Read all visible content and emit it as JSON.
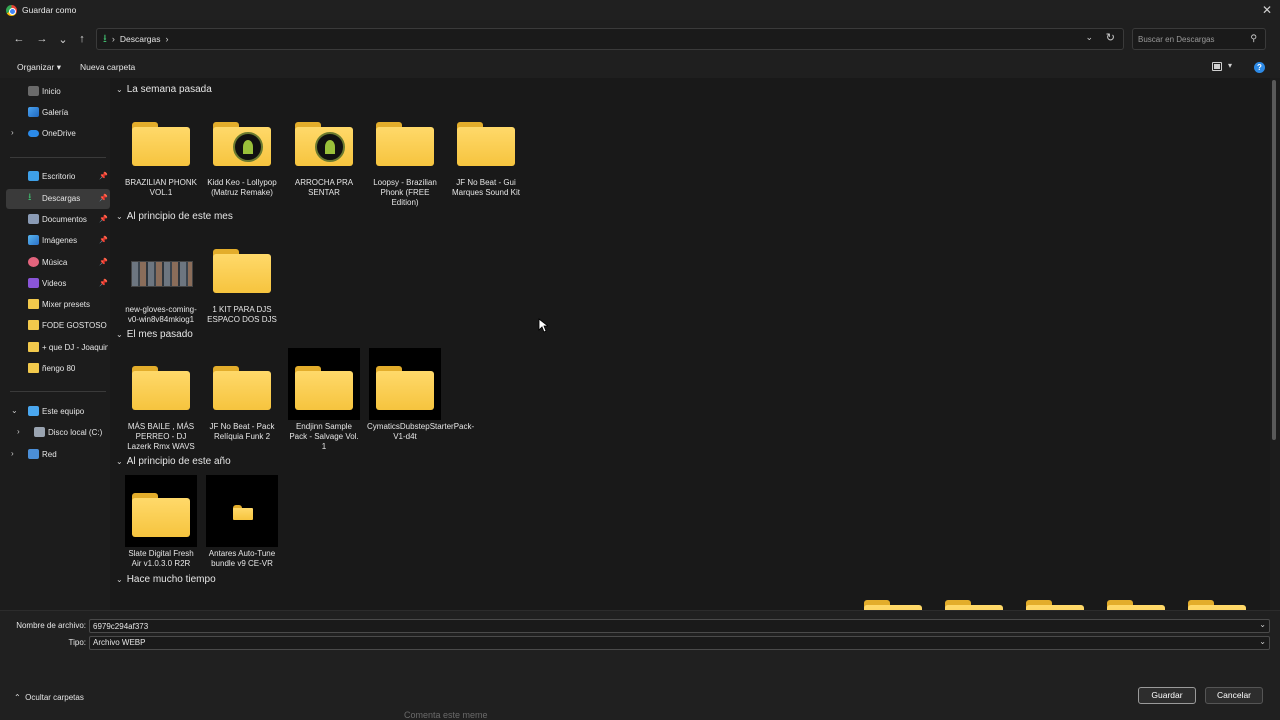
{
  "window": {
    "title": "Guardar como",
    "close_label": "✕"
  },
  "nav": {
    "back": "←",
    "forward": "→",
    "recent": "⌄",
    "up": "↑",
    "breadcrumb": [
      "Descargas"
    ],
    "search_placeholder": "Buscar en Descargas"
  },
  "commands": {
    "organize": "Organizar",
    "new_folder": "Nueva carpeta"
  },
  "sidebar": {
    "items": [
      {
        "label": "Inicio",
        "icon": "home-icon"
      },
      {
        "label": "Galería",
        "icon": "gallery-icon"
      },
      {
        "label": "OneDrive",
        "icon": "onedrive-icon"
      },
      {
        "label": "Escritorio",
        "icon": "desktop-icon",
        "pinned": true
      },
      {
        "label": "Descargas",
        "icon": "download-icon",
        "pinned": true,
        "active": true
      },
      {
        "label": "Documentos",
        "icon": "documents-icon",
        "pinned": true
      },
      {
        "label": "Imágenes",
        "icon": "images-icon",
        "pinned": true
      },
      {
        "label": "Música",
        "icon": "music-icon",
        "pinned": true
      },
      {
        "label": "Videos",
        "icon": "videos-icon",
        "pinned": true
      },
      {
        "label": "Mixer presets",
        "icon": "folder-icon"
      },
      {
        "label": "FODE GOSTOSO",
        "icon": "folder-icon"
      },
      {
        "label": "+ que DJ - Joaquin",
        "icon": "folder-icon"
      },
      {
        "label": "ñengo 80",
        "icon": "folder-icon"
      },
      {
        "label": "Este equipo",
        "icon": "pc-icon"
      },
      {
        "label": "Disco local (C:)",
        "icon": "disk-icon"
      },
      {
        "label": "Red",
        "icon": "network-icon"
      }
    ]
  },
  "groups": [
    {
      "title": "La semana pasada",
      "items": [
        {
          "name": "BRAZILIAN PHONK VOL.1"
        },
        {
          "name": "Kidd Keo - Lollypop (Matruz Remake)"
        },
        {
          "name": "ARROCHA PRA SENTAR"
        },
        {
          "name": "Loopsy - Brazilian Phonk (FREE Edition)"
        },
        {
          "name": "JF No Beat - Gui Marques Sound Kit"
        }
      ]
    },
    {
      "title": "Al principio de este mes",
      "items": [
        {
          "name": "new-gloves-coming-v0-win8v84mkiog1"
        },
        {
          "name": "1 KIT PARA DJS ESPACO DOS DJS"
        }
      ]
    },
    {
      "title": "El mes pasado",
      "items": [
        {
          "name": "MÁS BAILE , MÁS PERREO - DJ Lazerk Rmx WAVS"
        },
        {
          "name": "JF No Beat - Pack Relíquia Funk 2"
        },
        {
          "name": "Endjinn Sample Pack - Salvage Vol. 1"
        },
        {
          "name": "CymaticsDubstepStarterPack-V1-d4t"
        }
      ]
    },
    {
      "title": "Al principio de este año",
      "items": [
        {
          "name": "Slate Digital Fresh Air v1.0.3.0 R2R"
        },
        {
          "name": "Antares Auto-Tune bundle v9 CE-VR"
        }
      ]
    },
    {
      "title": "Hace mucho tiempo",
      "items": []
    }
  ],
  "bottom": {
    "filename_label": "Nombre de archivo:",
    "filename_value": "6979c294af373",
    "type_label": "Tipo:",
    "type_value": "Archivo WEBP",
    "hide_folders": "Ocultar carpetas",
    "save": "Guardar",
    "cancel": "Cancelar"
  },
  "behind_text": "Comenta este meme"
}
